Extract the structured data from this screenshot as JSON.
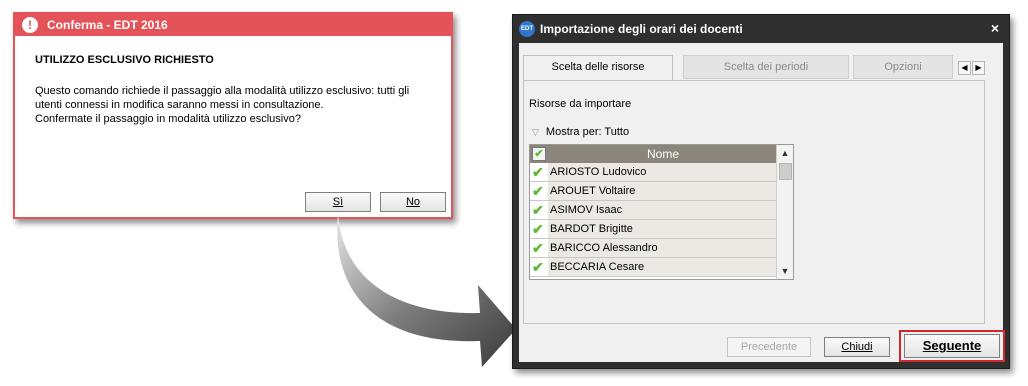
{
  "confirm": {
    "title": "Conferma - EDT 2016",
    "warning_icon": "!",
    "heading": "UTILIZZO ESCLUSIVO RICHIESTO",
    "message_lines": [
      "Questo comando  richiede il passaggio alla modalità utilizzo esclusivo: tutti gli",
      "utenti connessi in modifica saranno messi in consultazione.",
      "Confermate il passaggio in modalità utilizzo esclusivo?"
    ],
    "yes_label": "Sì",
    "no_label": "No",
    "accent_color": "#e5535a"
  },
  "import": {
    "logo": "EDT",
    "title": "Importazione degli orari dei docenti",
    "close_icon": "×",
    "tabs": [
      {
        "label": "Scelta delle risorse",
        "active": true
      },
      {
        "label": "Scelta dei periodi",
        "active": false
      },
      {
        "label": "Opzioni",
        "active": false
      }
    ],
    "resources_label": "Risorse da importare",
    "show_for_label": "Mostra per: Tutto",
    "column_header": "Nome",
    "rows": [
      "ARIOSTO Ludovico",
      "AROUET Voltaire",
      "ASIMOV Isaac",
      "BARDOT Brigitte",
      "BARICCO Alessandro",
      "BECCARIA Cesare"
    ],
    "buttons": {
      "previous": "Precedente",
      "close": "Chiudi",
      "next": "Seguente"
    },
    "highlight_color": "#d2272b"
  }
}
